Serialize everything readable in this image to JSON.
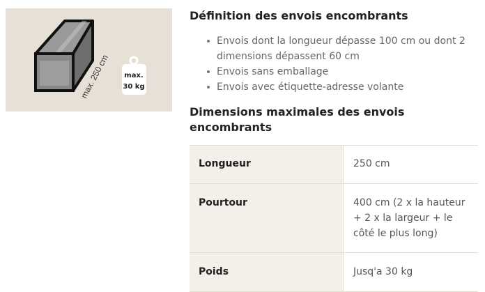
{
  "illustration": {
    "dimension_label": "max. 250 cm",
    "weight_label_line1": "max.",
    "weight_label_line2": "30 kg",
    "background": "#e6e0d6"
  },
  "section1": {
    "title": "Définition des envois encombrants",
    "bullets": [
      "Envois dont la longueur dépasse 100 cm ou dont 2 dimensions dépassent 60 cm",
      "Envois sans emballage",
      "Envois avec étiquette-adresse volante"
    ]
  },
  "section2": {
    "title": "Dimensions maximales des envois encombrants",
    "rows": [
      {
        "key": "Longueur",
        "value": "250 cm"
      },
      {
        "key": "Pourtour",
        "value": "400 cm (2 x la hauteur + 2 x la largeur + le côté le plus long)"
      },
      {
        "key": "Poids",
        "value": "Jusq'a 30 kg"
      }
    ]
  }
}
